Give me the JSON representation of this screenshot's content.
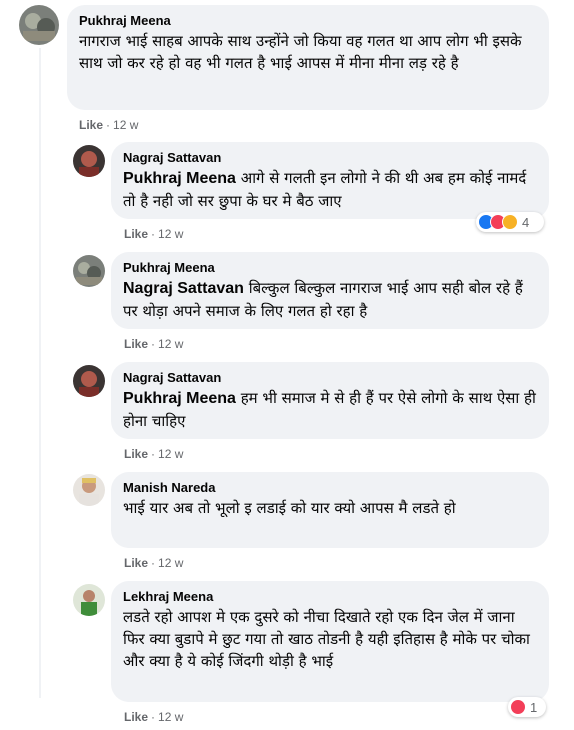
{
  "comments": [
    {
      "author": "Pukhraj Meena",
      "mention": "",
      "text": "नागराज भाई साहब आपके साथ उन्होंने जो किया वह गलत था आप लोग भी इसके साथ जो कर रहे हो वह भी गलत है भाई आपस में मीना मीना लड़ रहे है",
      "like_label": "Like",
      "age": "12 w"
    },
    {
      "author": "Nagraj Sattavan",
      "mention": "Pukhraj Meena",
      "text": " आगे से गलती इन लोगो ने की थी अब हम कोई नामर्द तो है नही जो सर छुपा के घर मे बैठ जाए",
      "like_label": "Like",
      "age": "12 w",
      "reactions": {
        "count": "4",
        "icons": [
          "like-icon",
          "love-icon",
          "care-icon"
        ]
      }
    },
    {
      "author": "Pukhraj Meena",
      "mention": "Nagraj Sattavan",
      "text": " बिल्कुल बिल्कुल नागराज भाई आप सही बोल रहे हैं पर थोड़ा अपने समाज के लिए गलत हो रहा है",
      "like_label": "Like",
      "age": "12 w"
    },
    {
      "author": "Nagraj Sattavan",
      "mention": "Pukhraj Meena",
      "text": " हम भी समाज मे से ही हैं पर ऐसे लोगो के साथ ऐसा ही होना चाहिए",
      "like_label": "Like",
      "age": "12 w"
    },
    {
      "author": "Manish Nareda",
      "mention": "",
      "text": "भाई यार अब तो भूलो इ लडाई को यार क्यो आपस मै लडते हो",
      "like_label": "Like",
      "age": "12 w"
    },
    {
      "author": "Lekhraj Meena",
      "mention": "",
      "text": "लडते रहो आपश मे एक दुसरे को नीचा दिखाते रहो एक दिन जेल में जाना फिर क्या बुडापे मे छुट गया तो खाठ तोडनी है यही इतिहास है मोके पर चोका और क्या है ये कोई जिंदगी थोड़ी है भाई",
      "like_label": "Like",
      "age": "12 w",
      "reactions": {
        "count": "1",
        "icons": [
          "love-icon"
        ]
      }
    }
  ],
  "separator": "·",
  "colors": {
    "bubble": "#f0f2f5",
    "meta_text": "#65676b",
    "like_blue": "#1877f2",
    "love_red": "#f33e58",
    "care_yellow": "#f7b125"
  }
}
